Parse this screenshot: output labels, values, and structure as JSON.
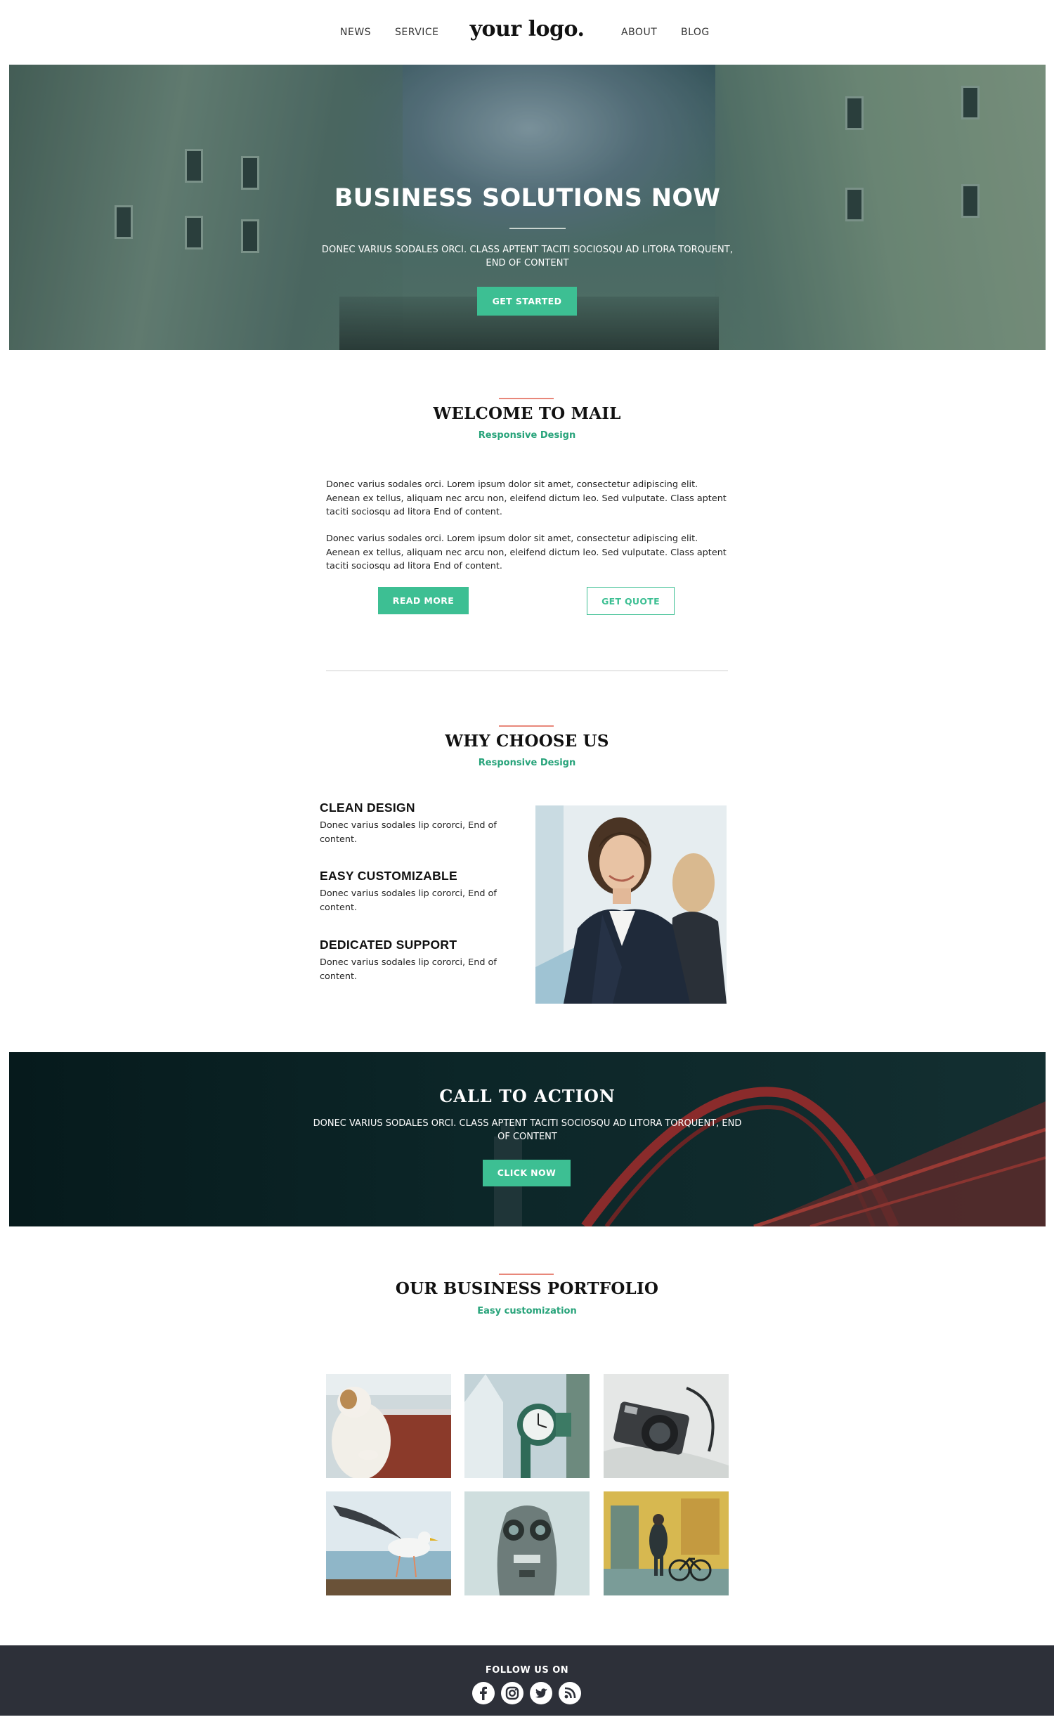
{
  "nav": {
    "news": "NEWS",
    "service": "SERVICE",
    "logo": "your logo.",
    "about": "ABOUT",
    "blog": "BLOG"
  },
  "hero": {
    "title": "BUSINESS SOLUTIONS NOW",
    "text": "DONEC VARIUS SODALES ORCI. CLASS APTENT TACITI SOCIOSQU AD LITORA TORQUENT, END OF CONTENT",
    "button": "GET STARTED"
  },
  "welcome": {
    "title": "WELCOME TO MAIL",
    "subtitle": "Responsive Design",
    "paragraphs": [
      "Donec varius sodales orci. Lorem ipsum dolor sit amet, consectetur adipiscing elit. Aenean ex tellus, aliquam nec arcu non, eleifend dictum leo. Sed vulputate. Class aptent taciti sociosqu ad litora End of content.",
      "Donec varius sodales orci. Lorem ipsum dolor sit amet, consectetur adipiscing elit. Aenean ex tellus, aliquam nec arcu non, eleifend dictum leo. Sed vulputate. Class aptent taciti sociosqu ad litora End of content."
    ],
    "read_more": "READ MORE",
    "get_quote": "GET QUOTE"
  },
  "why": {
    "title": "WHY CHOOSE US",
    "subtitle": "Responsive Design",
    "features": [
      {
        "title": "CLEAN DESIGN",
        "text": "Donec varius sodales lip cororci, End of content."
      },
      {
        "title": "EASY CUSTOMIZABLE",
        "text": "Donec varius sodales lip cororci, End of content."
      },
      {
        "title": "DEDICATED SUPPORT",
        "text": "Donec varius sodales lip cororci, End of content."
      }
    ]
  },
  "cta": {
    "title": "CALL  TO  ACTION",
    "text": "DONEC VARIUS SODALES ORCI. CLASS APTENT TACITI SOCIOSQU AD LITORA TORQUENT, END OF CONTENT",
    "button": "CLICK NOW"
  },
  "portfolio": {
    "title": "OUR BUSINESS PORTFOLIO",
    "subtitle": "Easy customization",
    "images": [
      "cat-at-window",
      "street-clock",
      "camera",
      "seagull",
      "coin-binoculars",
      "man-with-bicycle"
    ]
  },
  "footer": {
    "follow": "FOLLOW  US  ON",
    "social": [
      "facebook-icon",
      "instagram-icon",
      "twitter-icon",
      "rss-icon"
    ]
  },
  "colors": {
    "accent_green": "#3dbf93",
    "subtitle_green": "#27a37a",
    "accent_red": "#e8877a",
    "footer_bg": "#2d3039"
  }
}
